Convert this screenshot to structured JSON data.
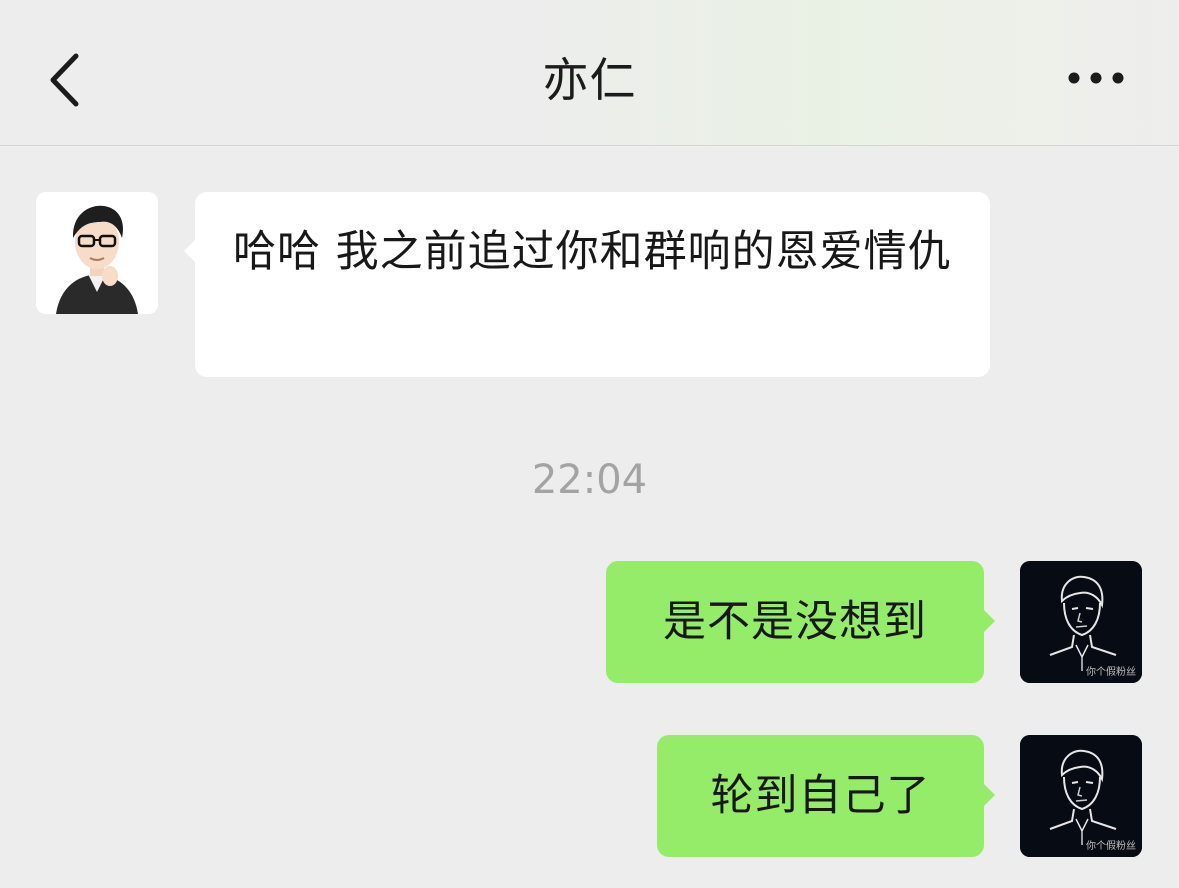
{
  "header": {
    "title": "亦仁",
    "back_icon": "chevron-left-icon",
    "more_icon": "more-horizontal-icon"
  },
  "messages": [
    {
      "sender": "other",
      "text": "哈哈 我之前追过你和群响的恩爱情仇"
    },
    {
      "sender": "me",
      "text": "是不是没想到",
      "avatar_watermark": "你个假粉丝"
    },
    {
      "sender": "me",
      "text": "轮到自己了",
      "avatar_watermark": "你个假粉丝"
    }
  ],
  "timestamp": "22:04",
  "colors": {
    "background": "#ededed",
    "my_bubble": "#95ec69",
    "their_bubble": "#ffffff",
    "timestamp_text": "#a3a3a3"
  }
}
